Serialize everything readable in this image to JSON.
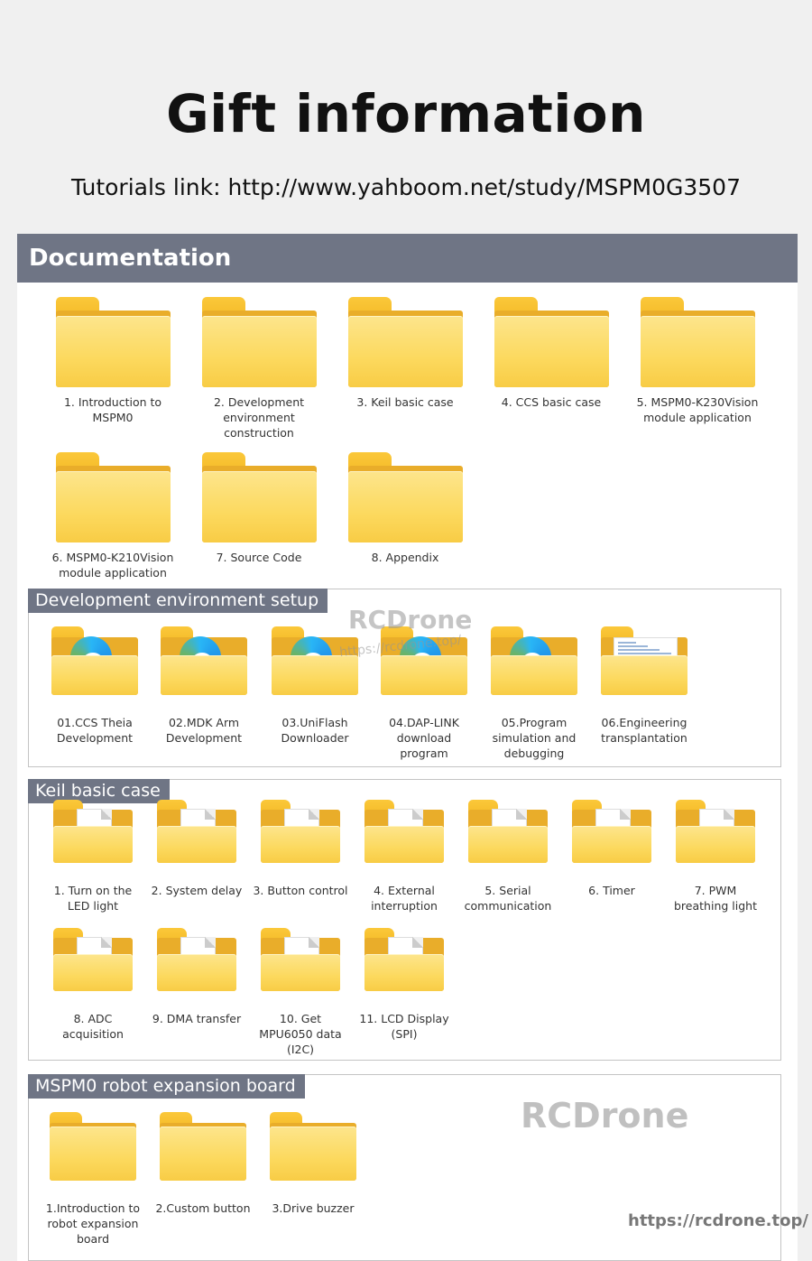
{
  "header": {
    "title": "Gift information",
    "tutorials": "Tutorials link: http://www.yahboom.net/study/MSPM0G3507"
  },
  "documentation": {
    "heading": "Documentation",
    "folders": [
      {
        "label": "1. Introduction to\nMSPM0"
      },
      {
        "label": "2. Development\nenvironment\nconstruction"
      },
      {
        "label": "3. Keil basic case"
      },
      {
        "label": "4. CCS basic case"
      },
      {
        "label": "5. MSPM0-K230Vision\nmodule application"
      },
      {
        "label": "6. MSPM0-K210Vision\nmodule application"
      },
      {
        "label": "7. Source Code"
      },
      {
        "label": "8. Appendix"
      }
    ]
  },
  "dev_env": {
    "heading": "Development environment setup",
    "folders": [
      {
        "label": "01.CCS Theia\nDevelopment",
        "icon": "browser-folder-icon"
      },
      {
        "label": "02.MDK Arm\nDevelopment",
        "icon": "browser-folder-icon"
      },
      {
        "label": "03.UniFlash\nDownloader",
        "icon": "browser-folder-icon"
      },
      {
        "label": "04.DAP-LINK\ndownload\nprogram",
        "icon": "browser-folder-icon"
      },
      {
        "label": "05.Program\nsimulation and\ndebugging",
        "icon": "browser-folder-icon"
      },
      {
        "label": "06.Engineering\ntransplantation",
        "icon": "screenshot-folder-icon"
      }
    ]
  },
  "keil": {
    "heading": "Keil basic case",
    "folders": [
      {
        "label": "1. Turn on the\nLED light"
      },
      {
        "label": "2. System delay"
      },
      {
        "label": "3. Button control"
      },
      {
        "label": "4. External\ninterruption"
      },
      {
        "label": "5. Serial\ncommunication"
      },
      {
        "label": "6. Timer"
      },
      {
        "label": "7. PWM\nbreathing light"
      },
      {
        "label": "8. ADC\nacquisition"
      },
      {
        "label": "9. DMA transfer"
      },
      {
        "label": "10. Get\nMPU6050 data\n(I2C)"
      },
      {
        "label": "11. LCD Display\n(SPI)"
      }
    ]
  },
  "robot": {
    "heading": "MSPM0 robot expansion board",
    "folders": [
      {
        "label": "1.Introduction to\nrobot expansion\nboard"
      },
      {
        "label": "2.Custom button"
      },
      {
        "label": "3.Drive buzzer"
      }
    ]
  },
  "watermarks": {
    "brand": "RCDrone",
    "url": "https://rcdrone.top/"
  }
}
